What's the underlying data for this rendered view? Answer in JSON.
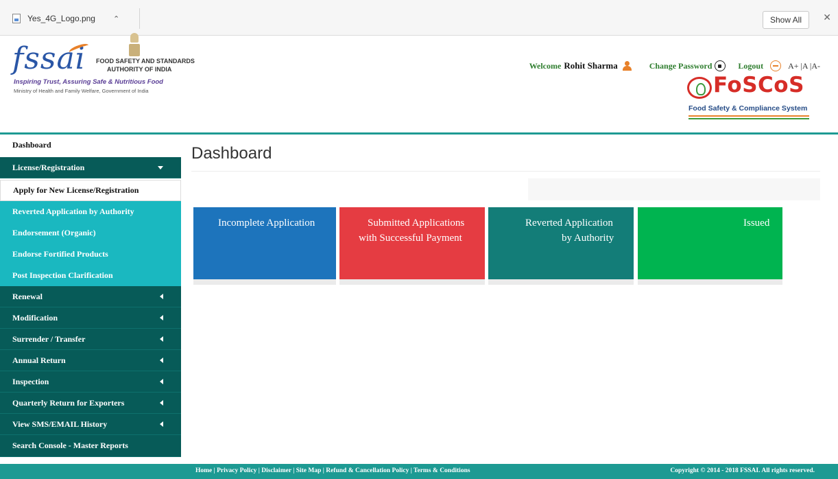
{
  "download_bar": {
    "file_name": "Yes_4G_Logo.png",
    "show_all_label": "Show All",
    "close_glyph": "✕"
  },
  "header": {
    "logo_word": "fssai",
    "org_line1": "FOOD SAFETY AND STANDARDS",
    "org_line2": "AUTHORITY OF INDIA",
    "tagline": "Inspiring Trust, Assuring Safe & Nutritious Food",
    "ministry": "Ministry of Health and Family Welfare, Government of India",
    "welcome_label": "Welcome",
    "user_name": "Rohit Sharma",
    "change_password_label": "Change Password",
    "logout_label": "Logout",
    "font_size_controls": "A+ |A |A-",
    "foscos_word": "FoSCoS",
    "foscos_subtitle": "Food Safety & Compliance System",
    "accent_color": "#1d9a93"
  },
  "sidebar": {
    "dashboard": "Dashboard",
    "license_registration": "License/Registration",
    "apply_new": "Apply for New License/Registration",
    "submenu": [
      "Reverted Application by Authority",
      "Endorsement (Organic)",
      "Endorse Fortified Products",
      "Post Inspection Clarification"
    ],
    "sections": [
      "Renewal",
      "Modification",
      "Surrender / Transfer",
      "Annual Return",
      "Inspection",
      "Quarterly Return for Exporters",
      "View SMS/EMAIL History"
    ],
    "search_console": "Search Console - Master Reports"
  },
  "main": {
    "title": "Dashboard",
    "cards": [
      {
        "line1": "Incomplete Application",
        "line2": "",
        "color": "#1d74bc"
      },
      {
        "line1": "Submitted Applications",
        "line2": "with Successful Payment",
        "color": "#e53c42"
      },
      {
        "line1": "Reverted Application",
        "line2": "by Authority",
        "color": "#137d78"
      },
      {
        "line1": "Issued",
        "line2": "",
        "color": "#00b450"
      }
    ]
  },
  "footer": {
    "links": "Home | Privacy Policy | Disclaimer | Site Map | Refund & Cancellation Policy | Terms & Conditions",
    "copyright": "Copyright © 2014 - 2018 FSSAI. All rights reserved."
  }
}
